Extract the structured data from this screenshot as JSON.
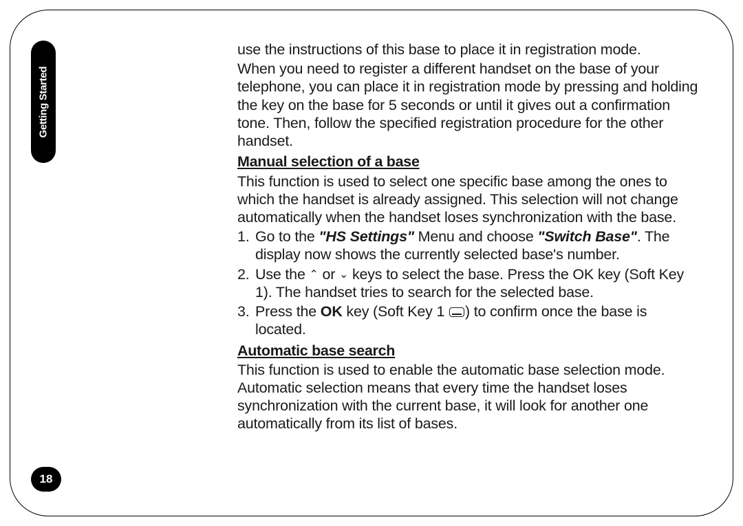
{
  "sideTab": {
    "label": "Getting Started"
  },
  "pageNumber": "18",
  "paragraphs": {
    "intro1": "use the instructions of this base to place it in registration mode.",
    "intro2": "When you need to register a different handset on the base of your telephone, you can place it in registration mode by pressing and holding the key on the base for 5 seconds or until it gives out a confirmation tone. Then, follow the specified registration procedure for the other handset."
  },
  "sectionA": {
    "heading": "Manual selection of a base",
    "intro": "This function is used to select one specific base among the ones to which the handset is already assigned. This selection will not change automatically when the handset loses synchronization with the base.",
    "steps": {
      "s1_a": "Go to the ",
      "s1_hs": "\"HS Settings\"",
      "s1_b": " Menu and choose ",
      "s1_sb": "\"Switch Base\"",
      "s1_c": ". The display now shows the currently selected base's number.",
      "s2_a": "Use the ",
      "s2_b": " or ",
      "s2_c": " keys to select the base. Press the OK key (Soft Key 1). The handset tries to search for the selected base.",
      "s3_a": "Press the ",
      "s3_ok": "OK",
      "s3_b": " key (Soft Key 1 ",
      "s3_c": ") to confirm once the base is located."
    }
  },
  "sectionB": {
    "heading": "Automatic base search",
    "intro": "This function is used to enable the automatic base selection mode. Automatic selection means that every time the handset loses synchronization with the current base, it will look for another one automatically from its list of bases."
  },
  "chart_data": null
}
